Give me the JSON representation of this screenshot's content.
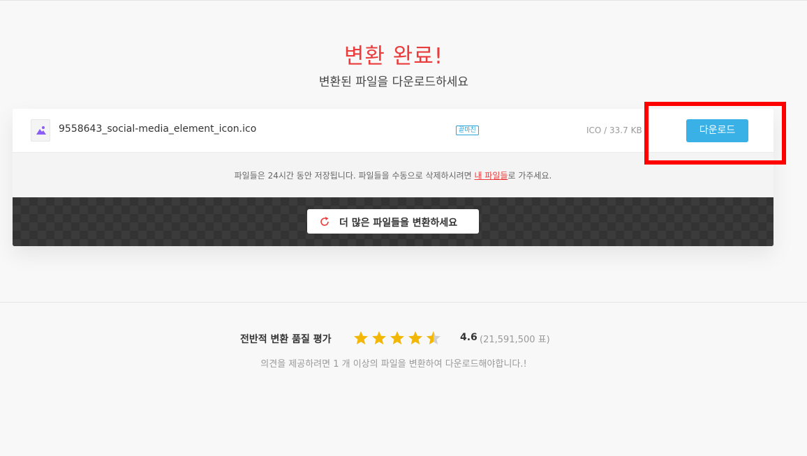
{
  "header": {
    "title": "변환 완료!",
    "subtitle": "변환된 파일을 다운로드하세요"
  },
  "file": {
    "icon": "image-icon",
    "name": "9558643_social-media_element_icon.ico",
    "badge": "끝마친",
    "meta": "ICO / 33.7 KB",
    "download_label": "다운로드"
  },
  "notice": {
    "before": "파일들은 24시간 동안 저장됩니다. 파일들을 수동으로 삭제하시려면 ",
    "link": "내 파일들",
    "after": "로 가주세요."
  },
  "more": {
    "icon": "refresh-icon",
    "label": "더 많은 파일들을 변환하세요"
  },
  "rating": {
    "label": "전반적 변환 품질 평가",
    "score": "4.6",
    "stars_value": 4.6,
    "stars_max": 5,
    "votes": "(21,591,500 표)",
    "note": "의견을 제공하려면 1 개 이상의 파일을 변환하여 다운로드해야합니다.!"
  },
  "colors": {
    "accent_red": "#ea3c3c",
    "download_blue": "#3ab1e6",
    "star_gold": "#f2b705",
    "highlight_box": "#ff0000"
  }
}
